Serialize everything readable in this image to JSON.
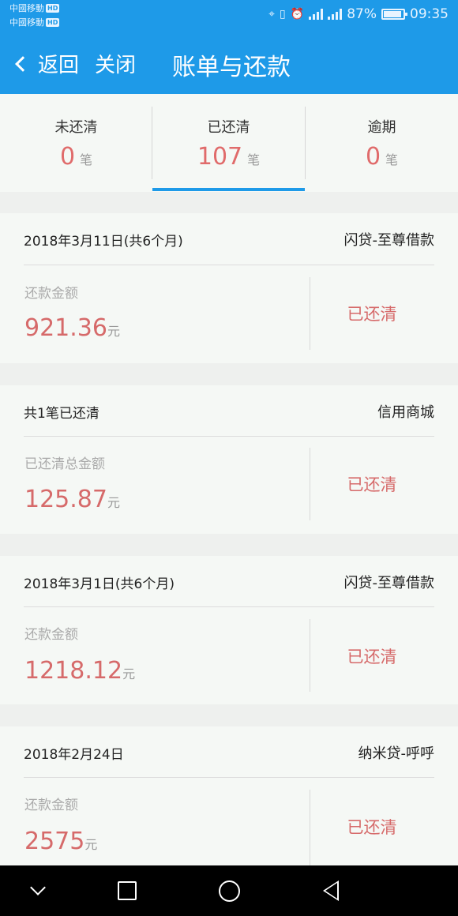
{
  "status_bar": {
    "carrier_1": "中國移動",
    "carrier_2": "中國移動",
    "hd": "HD",
    "battery": "87%",
    "time": "09:35"
  },
  "nav": {
    "back_label": "返回",
    "close_label": "关闭",
    "title": "账单与还款"
  },
  "tabs": [
    {
      "label": "未还清",
      "count": "0",
      "unit": "笔"
    },
    {
      "label": "已还清",
      "count": "107",
      "unit": "笔"
    },
    {
      "label": "逾期",
      "count": "0",
      "unit": "笔"
    }
  ],
  "bills": [
    {
      "left": "2018年3月11日(共6个月)",
      "right": "闪贷-至尊借款",
      "amount_label": "还款金额",
      "amount": "921.36",
      "unit": "元",
      "status": "已还清"
    },
    {
      "left": "共1笔已还清",
      "right": "信用商城",
      "amount_label": "已还清总金额",
      "amount": "125.87",
      "unit": "元",
      "status": "已还清"
    },
    {
      "left": "2018年3月1日(共6个月)",
      "right": "闪贷-至尊借款",
      "amount_label": "还款金额",
      "amount": "1218.12",
      "unit": "元",
      "status": "已还清"
    },
    {
      "left": "2018年2月24日",
      "right": "纳米贷-呼呼",
      "amount_label": "还款金额",
      "amount": "2575",
      "unit": "元",
      "status": "已还清"
    }
  ],
  "colors": {
    "header_blue": "#1e9ae8",
    "amount_red": "#d66a6a",
    "background": "#eef0ee"
  }
}
